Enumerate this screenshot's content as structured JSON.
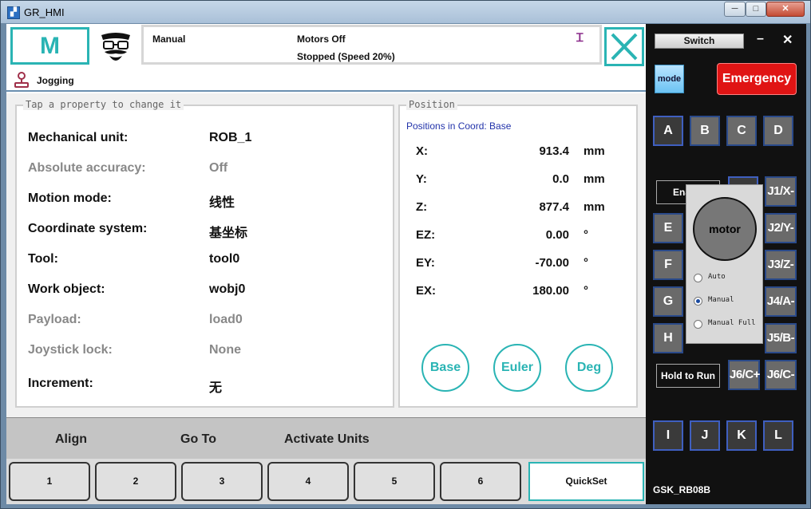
{
  "window": {
    "title": "GR_HMI",
    "min_glyph": "─",
    "max_glyph": "□",
    "close_glyph": "✕"
  },
  "header": {
    "logo_text": "M",
    "mode": "Manual",
    "motors": "Motors Off",
    "status": "Stopped (Speed 20%)",
    "status_icon": "Ꮖ",
    "close_glyph": "✕"
  },
  "jogging": {
    "label": "Jogging"
  },
  "properties": {
    "title": "Tap a property to change it",
    "rows": [
      {
        "label": "Mechanical unit:",
        "value": "ROB_1"
      },
      {
        "label": "Absolute accuracy:",
        "value": "Off"
      },
      {
        "label": "Motion mode:",
        "value": "线性"
      },
      {
        "label": "Coordinate system:",
        "value": "基坐标"
      },
      {
        "label": "Tool:",
        "value": "tool0"
      },
      {
        "label": "Work object:",
        "value": "wobj0"
      },
      {
        "label": "Payload:",
        "value": "load0"
      },
      {
        "label": "Joystick lock:",
        "value": "None"
      },
      {
        "label": "Increment:",
        "value": "无"
      }
    ]
  },
  "position": {
    "title": "Position",
    "coord": "Positions in Coord: Base",
    "rows": [
      {
        "axis": "X:",
        "value": "913.4",
        "unit": "mm"
      },
      {
        "axis": "Y:",
        "value": "0.0",
        "unit": "mm"
      },
      {
        "axis": "Z:",
        "value": "877.4",
        "unit": "mm"
      },
      {
        "axis": "EZ:",
        "value": "0.00",
        "unit": "°"
      },
      {
        "axis": "EY:",
        "value": "-70.00",
        "unit": "°"
      },
      {
        "axis": "EX:",
        "value": "180.00",
        "unit": "°"
      }
    ],
    "buttons": [
      "Base",
      "Euler",
      "Deg"
    ]
  },
  "toolbar": {
    "align": "Align",
    "goto": "Go To",
    "activate": "Activate Units"
  },
  "footer": {
    "buttons": [
      "1",
      "2",
      "3",
      "4",
      "5",
      "6"
    ],
    "quickset": "QuickSet"
  },
  "pendant": {
    "switch": "Switch",
    "min": "–",
    "close": "✕",
    "mode": "mode",
    "emergency": "Emergency",
    "keys_top": [
      "A",
      "B",
      "C",
      "D"
    ],
    "keys_left": [
      "E",
      "F",
      "G",
      "H"
    ],
    "keys_right": [
      "J1/X-",
      "J2/Y-",
      "J3/Z-",
      "J4/A-",
      "J5/B-",
      "J6/C-"
    ],
    "key_j6cplus": "J6/C+",
    "keys_bottom": [
      "I",
      "J",
      "K",
      "L"
    ],
    "enable": "Ena",
    "hold": "Hold to Run",
    "motor": "motor",
    "radios": [
      "Auto",
      "Manual",
      "Manual Full"
    ],
    "device": "GSK_RB08B"
  }
}
